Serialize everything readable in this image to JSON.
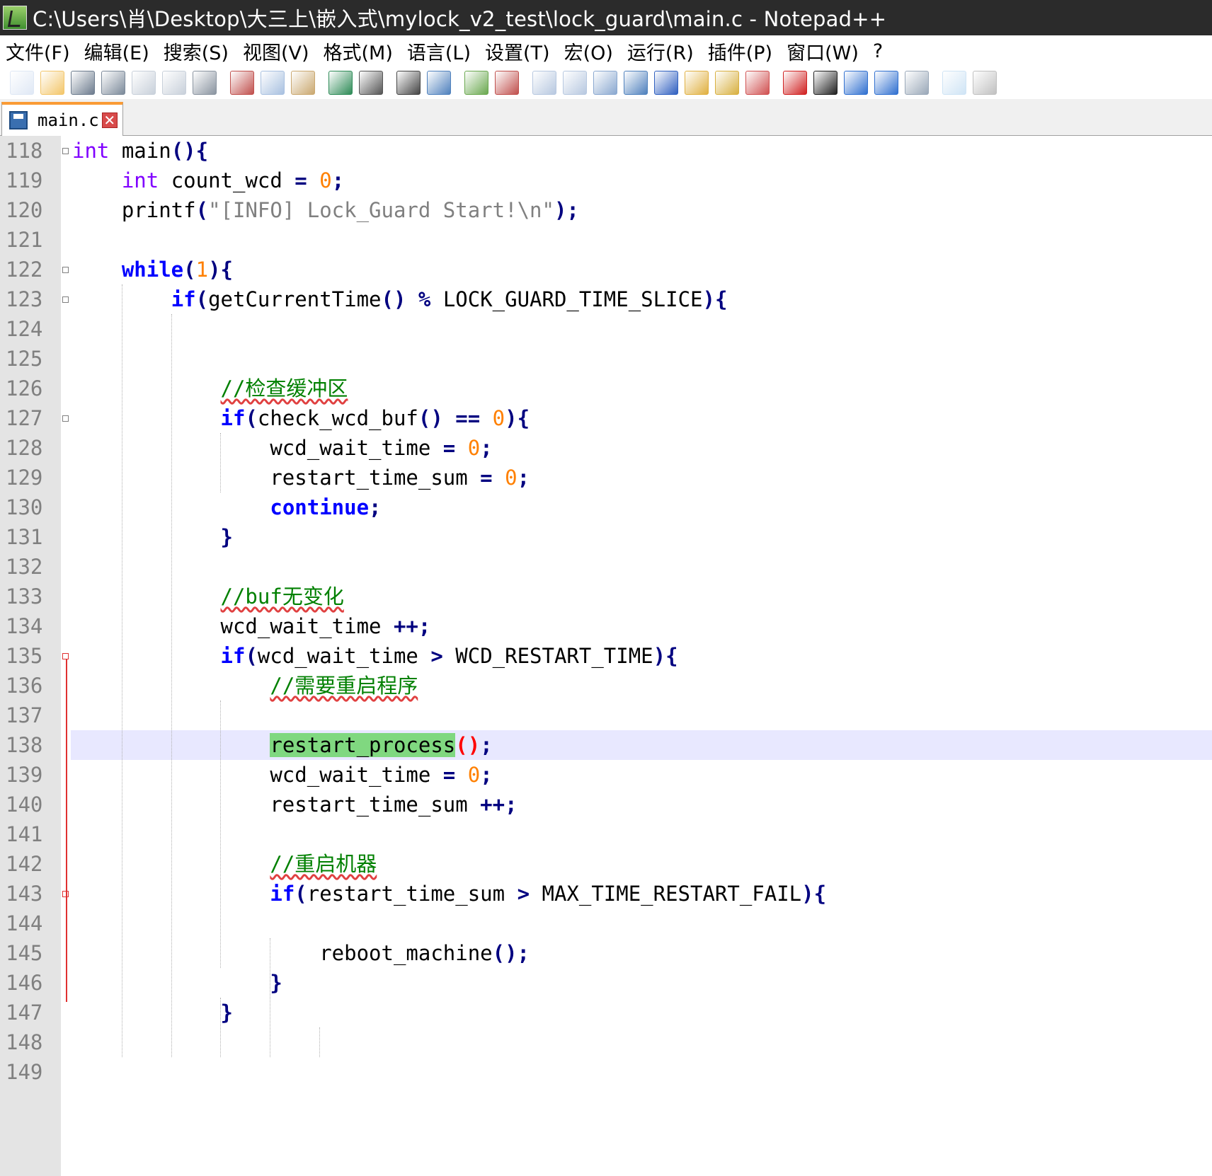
{
  "window": {
    "title": "C:\\Users\\肖\\Desktop\\大三上\\嵌入式\\mylock_v2_test\\lock_guard\\main.c - Notepad++"
  },
  "menu": [
    "文件(F)",
    "编辑(E)",
    "搜索(S)",
    "视图(V)",
    "格式(M)",
    "语言(L)",
    "设置(T)",
    "宏(O)",
    "运行(R)",
    "插件(P)",
    "窗口(W)",
    "?"
  ],
  "toolbar": {
    "icons": [
      "new-file-icon",
      "open-file-icon",
      "save-icon",
      "save-all-icon",
      "close-icon",
      "close-all-icon",
      "print-icon",
      "cut-icon",
      "copy-icon",
      "paste-icon",
      "undo-icon",
      "redo-icon",
      "find-icon",
      "replace-icon",
      "zoom-in-icon",
      "zoom-out-icon",
      "sync-vertical-icon",
      "sync-horizontal-icon",
      "word-wrap-icon",
      "show-all-chars-icon",
      "indent-guide-icon",
      "user-language-icon",
      "doc-map-icon",
      "function-list-icon",
      "record-macro-icon",
      "stop-macro-icon",
      "play-macro-icon",
      "run-macro-multiple-icon",
      "save-macro-icon",
      "spell-check-icon",
      "plugin-icon"
    ]
  },
  "tab": {
    "label": "main.c"
  },
  "editor": {
    "lines": [
      {
        "n": "118",
        "html": "<span class=\"type\">int</span> main<span class=\"op\">(){</span>"
      },
      {
        "n": "119",
        "html": "    <span class=\"type\">int</span> count_wcd <span class=\"op\">=</span> <span class=\"num\">0</span><span class=\"op\">;</span>"
      },
      {
        "n": "120",
        "html": "    printf<span class=\"op\">(</span><span class=\"str\">\"[INFO] Lock_Guard Start!\\n\"</span><span class=\"op\">);</span>"
      },
      {
        "n": "121",
        "html": ""
      },
      {
        "n": "122",
        "html": "    <span class=\"kw\">while</span><span class=\"op\">(</span><span class=\"num\">1</span><span class=\"op\">){</span>"
      },
      {
        "n": "123",
        "html": "        <span class=\"kw\">if</span><span class=\"op\">(</span>getCurrentTime<span class=\"op\">()</span> <span class=\"op\">%</span> LOCK_GUARD_TIME_SLICE<span class=\"op\">){</span>"
      },
      {
        "n": "124",
        "html": ""
      },
      {
        "n": "125",
        "html": ""
      },
      {
        "n": "126",
        "html": "            <span class=\"cmt\">//检查缓冲区</span>"
      },
      {
        "n": "127",
        "html": "            <span class=\"kw\">if</span><span class=\"op\">(</span>check_wcd_buf<span class=\"op\">()</span> <span class=\"op\">==</span> <span class=\"num\">0</span><span class=\"op\">){</span>"
      },
      {
        "n": "128",
        "html": "                wcd_wait_time <span class=\"op\">=</span> <span class=\"num\">0</span><span class=\"op\">;</span>"
      },
      {
        "n": "129",
        "html": "                restart_time_sum <span class=\"op\">=</span> <span class=\"num\">0</span><span class=\"op\">;</span>"
      },
      {
        "n": "130",
        "html": "                <span class=\"kw\">continue</span><span class=\"op\">;</span>"
      },
      {
        "n": "131",
        "html": "            <span class=\"op\">}</span>"
      },
      {
        "n": "132",
        "html": ""
      },
      {
        "n": "133",
        "html": "            <span class=\"cmt\">//buf无变化</span>"
      },
      {
        "n": "134",
        "html": "            wcd_wait_time <span class=\"op\">++;</span>"
      },
      {
        "n": "135",
        "html": "            <span class=\"kw\">if</span><span class=\"op\">(</span>wcd_wait_time <span class=\"op\">&gt;</span> WCD_RESTART_TIME<span class=\"op\">){</span>"
      },
      {
        "n": "136",
        "html": "                <span class=\"cmt\">//需要重启程序</span>"
      },
      {
        "n": "137",
        "html": ""
      },
      {
        "n": "138",
        "html": "                <span class=\"hl\">restart_process</span><span class=\"brace-hl\">()</span><span class=\"op\">;</span>"
      },
      {
        "n": "139",
        "html": "                wcd_wait_time <span class=\"op\">=</span> <span class=\"num\">0</span><span class=\"op\">;</span>"
      },
      {
        "n": "140",
        "html": "                restart_time_sum <span class=\"op\">++;</span>"
      },
      {
        "n": "141",
        "html": ""
      },
      {
        "n": "142",
        "html": "                <span class=\"cmt\">//重启机器</span>"
      },
      {
        "n": "143",
        "html": "                <span class=\"kw\">if</span><span class=\"op\">(</span>restart_time_sum <span class=\"op\">&gt;</span> MAX_TIME_RESTART_FAIL<span class=\"op\">){</span>"
      },
      {
        "n": "144",
        "html": ""
      },
      {
        "n": "145",
        "html": "                    reboot_machine<span class=\"op\">();</span>"
      },
      {
        "n": "146",
        "html": "                <span class=\"op\">}</span>"
      },
      {
        "n": "147",
        "html": "            <span class=\"op\">}</span>"
      },
      {
        "n": "148",
        "html": ""
      },
      {
        "n": "149",
        "html": ""
      }
    ],
    "fold_lines": [
      "118",
      "122",
      "123",
      "127",
      "135",
      "143"
    ],
    "current_line": "138"
  }
}
